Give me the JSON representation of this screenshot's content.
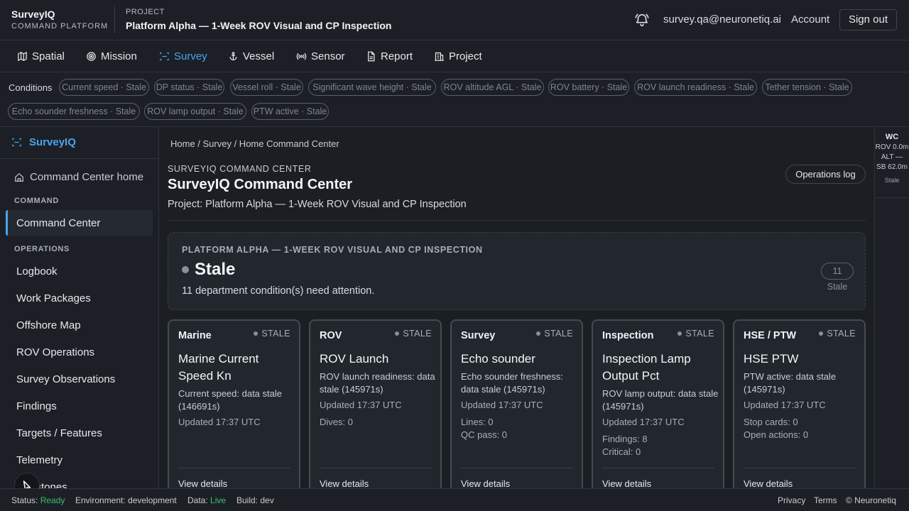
{
  "brand": {
    "name": "SurveyIQ",
    "sub": "COMMAND PLATFORM"
  },
  "project": {
    "label": "PROJECT",
    "title": "Platform Alpha — 1-Week ROV Visual and CP Inspection"
  },
  "user": {
    "email": "survey.qa@neuronetiq.ai",
    "account": "Account",
    "signout": "Sign out"
  },
  "nav": [
    {
      "label": "Spatial",
      "icon": "map-icon"
    },
    {
      "label": "Mission",
      "icon": "target-icon"
    },
    {
      "label": "Survey",
      "icon": "scan-icon"
    },
    {
      "label": "Vessel",
      "icon": "anchor-icon"
    },
    {
      "label": "Sensor",
      "icon": "radio-icon"
    },
    {
      "label": "Report",
      "icon": "document-icon"
    },
    {
      "label": "Project",
      "icon": "building-icon"
    }
  ],
  "conditions": {
    "label": "Conditions",
    "chips": [
      "Current speed · Stale",
      "DP status · Stale",
      "Vessel roll · Stale",
      "Significant wave height · Stale",
      "ROV altitude AGL · Stale",
      "ROV battery · Stale",
      "ROV launch readiness · Stale",
      "Tether tension · Stale",
      "Echo sounder freshness · Stale",
      "ROV lamp output · Stale",
      "PTW active · Stale"
    ]
  },
  "sidebar": {
    "brand": "SurveyIQ",
    "home": "Command Center home",
    "section_command": "COMMAND",
    "active": "Command Center",
    "section_operations": "OPERATIONS",
    "items": [
      "Logbook",
      "Work Packages",
      "Offshore Map",
      "ROV Operations",
      "Survey Observations",
      "Findings",
      "Targets / Features",
      "Telemetry",
      "Milestones"
    ]
  },
  "wc": {
    "title": "WC",
    "rov": "ROV 0.0m",
    "alt": "ALT —",
    "sb": "SB 62.0m",
    "status": "Stale"
  },
  "breadcrumb": "Home / Survey / Home Command Center",
  "header": {
    "eyebrow": "SURVEYIQ COMMAND CENTER",
    "title": "SurveyIQ Command Center",
    "subtitle": "Project: Platform Alpha — 1-Week ROV Visual and CP Inspection",
    "ops_button": "Operations log"
  },
  "banner": {
    "eyebrow": "PLATFORM ALPHA — 1-WEEK ROV VISUAL AND CP INSPECTION",
    "status": "Stale",
    "message": "11 department condition(s) need attention.",
    "badge": "11 Stale"
  },
  "cards": [
    {
      "dept": "Marine",
      "status": "STALE",
      "title": "Marine Current Speed Kn",
      "desc": "Current speed: data stale (146691s)",
      "updated": "Updated 17:37 UTC",
      "metrics": [],
      "link": "View details"
    },
    {
      "dept": "ROV",
      "status": "STALE",
      "title": "ROV Launch",
      "desc": "ROV launch readiness: data stale (145971s)",
      "updated": "Updated 17:37 UTC",
      "metrics": [
        "Dives: 0"
      ],
      "link": "View details"
    },
    {
      "dept": "Survey",
      "status": "STALE",
      "title": "Echo sounder",
      "desc": "Echo sounder freshness: data stale (145971s)",
      "updated": "Updated 17:37 UTC",
      "metrics": [
        "Lines: 0",
        "QC pass: 0"
      ],
      "link": "View details"
    },
    {
      "dept": "Inspection",
      "status": "STALE",
      "title": "Inspection Lamp Output Pct",
      "desc": "ROV lamp output: data stale (145971s)",
      "updated": "Updated 17:37 UTC",
      "metrics": [
        "Findings: 8",
        "Critical: 0"
      ],
      "link": "View details"
    },
    {
      "dept": "HSE / PTW",
      "status": "STALE",
      "title": "HSE PTW",
      "desc": "PTW active: data stale (145971s)",
      "updated": "Updated 17:37 UTC",
      "metrics": [
        "Stop cards: 0",
        "Open actions: 0"
      ],
      "link": "View details"
    }
  ],
  "footer": {
    "status_label": "Status:",
    "status_value": "Ready",
    "environment": "Environment: development",
    "data_label": "Data:",
    "data_value": "Live",
    "build": "Build: dev",
    "privacy": "Privacy",
    "terms": "Terms",
    "copyright": "© Neuronetiq"
  },
  "colors": {
    "accent": "#4aa3f0",
    "ok": "#3fbf70",
    "stale": "#8a9097"
  }
}
